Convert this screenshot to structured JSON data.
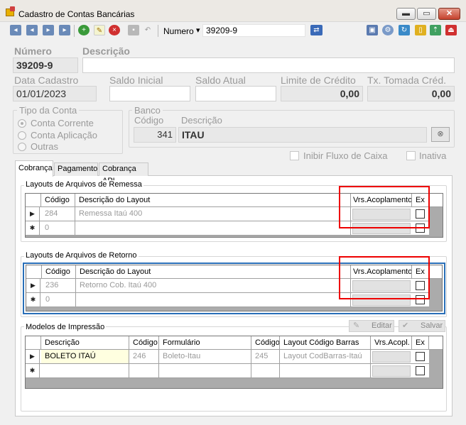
{
  "window": {
    "title": "Cadastro de Contas Bancárias",
    "min": "▬",
    "max": "▭",
    "close": "✕"
  },
  "toolbar": {
    "search_label": "Numero",
    "search_value": "39209-9"
  },
  "fields": {
    "numero_label": "Número",
    "numero_value": "39209-9",
    "descricao_label": "Descrição",
    "descricao_value": "",
    "data_label": "Data Cadastro",
    "data_value": "01/01/2023",
    "saldo_inicial_label": "Saldo Inicial",
    "saldo_atual_label": "Saldo Atual",
    "limite_label": "Limite de Crédito",
    "limite_value": "0,00",
    "tx_label": "Tx. Tomada Créd.",
    "tx_value": "0,00"
  },
  "tipo_conta": {
    "label": "Tipo da Conta",
    "options": [
      "Conta Corrente",
      "Conta Aplicação",
      "Outras"
    ]
  },
  "banco": {
    "label": "Banco",
    "codigo_label": "Código",
    "codigo_value": "341",
    "descricao_label": "Descrição",
    "descricao_value": "ITAU"
  },
  "checks": {
    "inibir": "Inibir Fluxo de Caixa",
    "inativa": "Inativa"
  },
  "tabs": [
    "Cobrança",
    "Pagamento",
    "Cobrança API"
  ],
  "remessa": {
    "title": "Layouts de Arquivos de Remessa",
    "headers": [
      "Código",
      "Descrição do Layout",
      "Vrs.Acoplamento",
      "Ex"
    ],
    "row1": {
      "codigo": "284",
      "descricao": "Remessa Itaú 400"
    },
    "new_codigo": "0"
  },
  "retorno": {
    "title": "Layouts de Arquivos de Retorno",
    "headers": [
      "Código",
      "Descrição do Layout",
      "Vrs.Acoplamento",
      "Ex"
    ],
    "row1": {
      "codigo": "236",
      "descricao": "Retorno Cob. Itaú 400"
    },
    "new_codigo": "0"
  },
  "modelos": {
    "title": "Modelos de Impressão",
    "editar": "Editar",
    "salvar": "Salvar",
    "headers": [
      "Descrição",
      "Código",
      "Formulário",
      "Código",
      "Layout Código Barras",
      "Vrs.Acopl.",
      "Ex"
    ],
    "row1": {
      "descricao": "BOLETO ITAÚ",
      "codigo": "246",
      "formulario": "Boleto-Itau",
      "codigo2": "245",
      "layout": "Layout CodBarras-Itaú"
    }
  },
  "markers": {
    "current": "▶",
    "new": "✱"
  }
}
